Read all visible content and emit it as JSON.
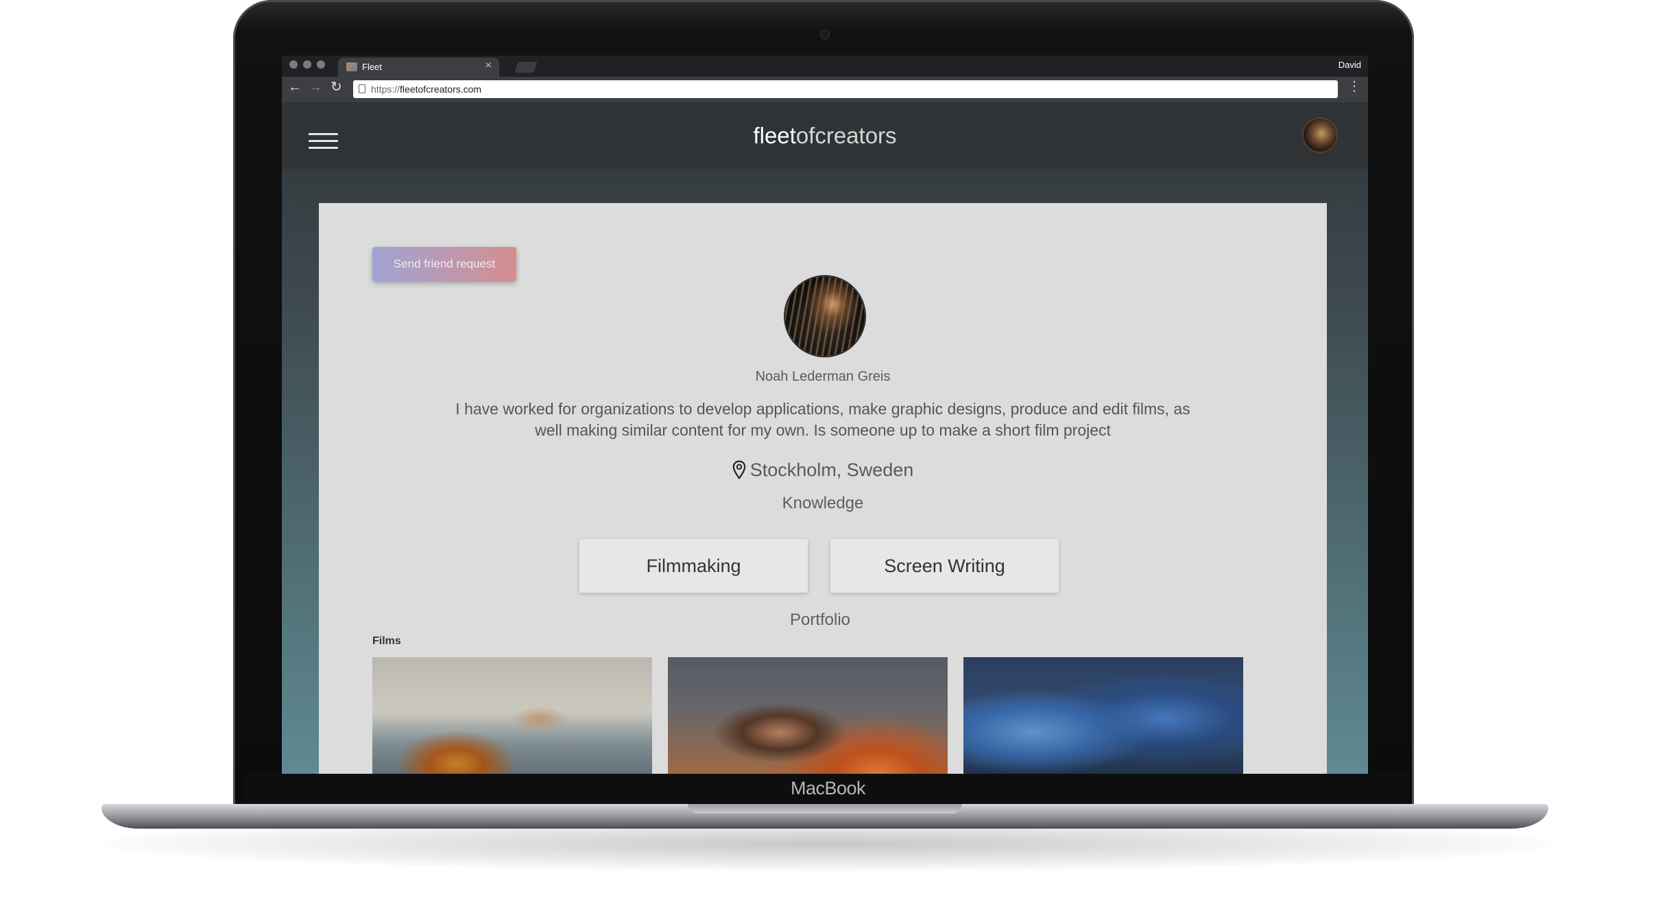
{
  "device": {
    "brand": "MacBook"
  },
  "browser": {
    "tab_title": "Fleet",
    "tab_close": "×",
    "profile_name": "David",
    "url_prefix": "https://",
    "url_domain": "fleetofcreators.com",
    "nav_icons": {
      "back": "←",
      "forward": "→",
      "reload": "↻",
      "menu": "⋮"
    }
  },
  "app": {
    "logo_bold": "fleet",
    "logo_light": "ofcreators"
  },
  "profile": {
    "friend_button": "Send friend request",
    "name": "Noah Lederman Greis",
    "bio": "I have worked for organizations to develop applications, make graphic designs, produce and edit films, as well making similar content for my own. Is someone up to make a short film project",
    "location": "Stockholm, Sweden",
    "knowledge_title": "Knowledge",
    "skills": [
      "Filmmaking",
      "Screen Writing"
    ],
    "portfolio_title": "Portfolio",
    "films_label": "Films",
    "film_count": 3
  },
  "colors": {
    "header_bg": "#2f3336",
    "card_bg": "#dcdcdc",
    "button_gradient_start": "#9fa3d4",
    "button_gradient_end": "#d68e8e",
    "page_gradient_bottom": "#5f8a92"
  }
}
